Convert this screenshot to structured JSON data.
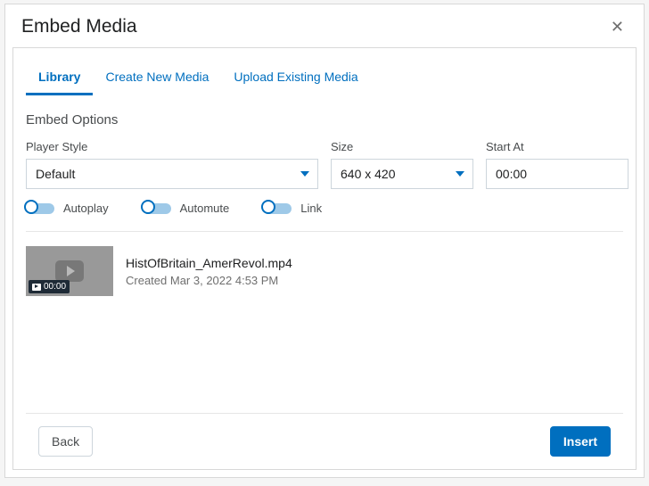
{
  "modal": {
    "title": "Embed Media"
  },
  "tabs": {
    "library": "Library",
    "create": "Create New Media",
    "upload": "Upload Existing Media"
  },
  "options": {
    "heading": "Embed Options",
    "player_style": {
      "label": "Player Style",
      "value": "Default"
    },
    "size": {
      "label": "Size",
      "value": "640 x 420"
    },
    "start_at": {
      "label": "Start At",
      "value": "00:00"
    },
    "toggles": {
      "autoplay": "Autoplay",
      "automute": "Automute",
      "link": "Link"
    }
  },
  "media": {
    "title": "HistOfBritain_AmerRevol.mp4",
    "created": "Created Mar 3, 2022 4:53 PM",
    "duration_badge": "00:00"
  },
  "footer": {
    "back": "Back",
    "insert": "Insert"
  }
}
